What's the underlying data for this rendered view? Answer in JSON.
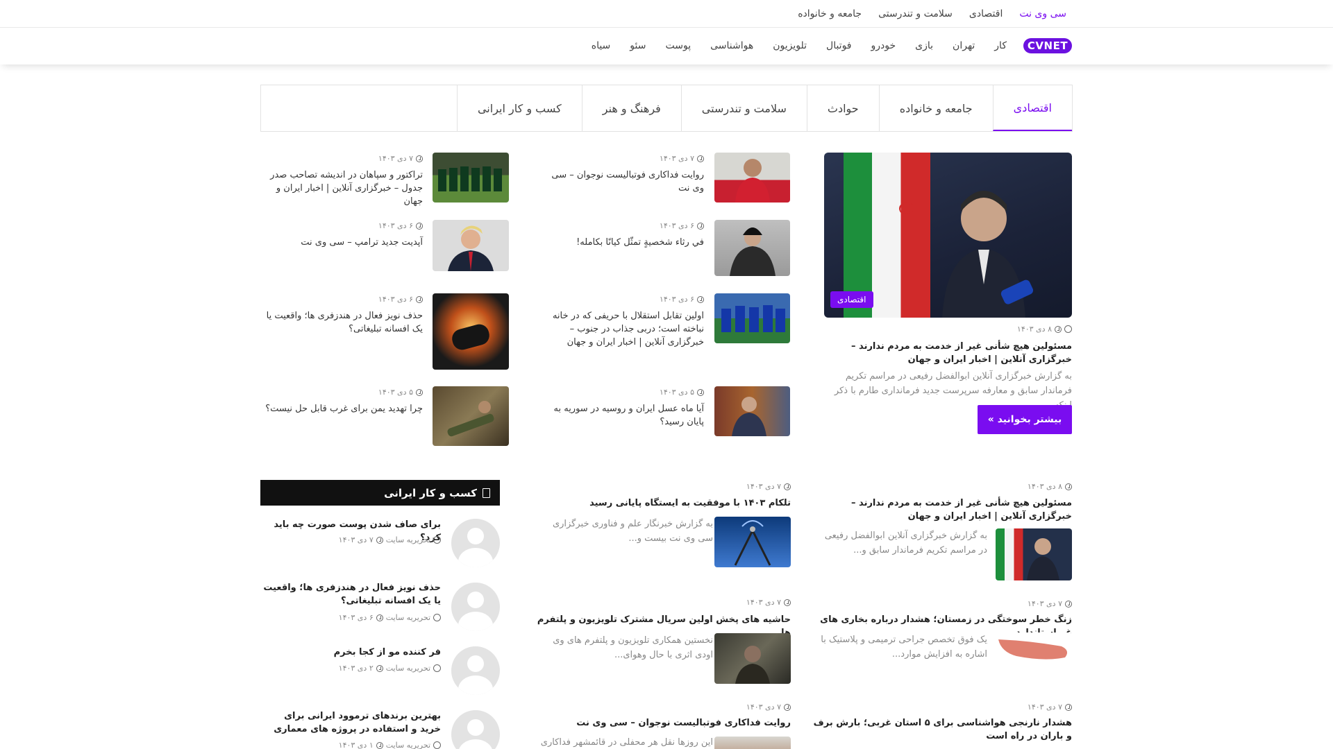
{
  "topbar": {
    "links": [
      "سی وی نت",
      "اقتصادی",
      "سلامت و تندرستی",
      "جامعه و خانواده"
    ]
  },
  "nav": {
    "logo": "CVNET",
    "links": [
      "کار",
      "تهران",
      "بازی",
      "خودرو",
      "فوتبال",
      "تلویزیون",
      "هواشناسی",
      "پوست",
      "سئو",
      "سیاه"
    ]
  },
  "tabs": [
    "اقتصادی",
    "جامعه و خانواده",
    "حوادث",
    "سلامت و تندرستی",
    "فرهنگ و هنر",
    "کسب و کار ایرانی"
  ],
  "featured": {
    "badge": "اقتصادی",
    "date": "۸ دی ۱۴۰۳",
    "title": "مسئولین هیچ شأنی غیر از خدمت به مردم ندارند – خبرگزاری آنلاین | اخبار ایران و جهان",
    "excerpt": "به گزارش خبرگزاری آنلاین ابوالفضل رفیعی در مراسم تکریم فرماندار سابق و معارفه سرپرست جدید فرمانداری طارم با ذکر اینکه...",
    "more": "بیشتر بخوانید »"
  },
  "mid_list": [
    {
      "date": "۷ دی ۱۴۰۳",
      "title": "روایت فداکاری فوتبالیست نوجوان – سی وی نت"
    },
    {
      "date": "۶ دی ۱۴۰۳",
      "title": "في رثاء شخصيةٍ تمثّل كيانًا بكامله!"
    },
    {
      "date": "۶ دی ۱۴۰۳",
      "title": "اولین تقابل استقلال با حریفی که در خانه نباخته است؛ دربی جذاب در جنوب – خبرگزاری آنلاین | اخبار ایران و جهان"
    },
    {
      "date": "۵ دی ۱۴۰۳",
      "title": "آیا ماه عسل ایران و روسیه در سوریه به پایان رسید؟"
    }
  ],
  "left_list": [
    {
      "date": "۷ دی ۱۴۰۳",
      "title": "تراکتور و سپاهان در اندیشه تصاحب صدر جدول – خبرگزاری آنلاین | اخبار ایران و جهان"
    },
    {
      "date": "۶ دی ۱۴۰۳",
      "title": "آپدیت جدید ترامپ – سی وی نت"
    },
    {
      "date": "۶ دی ۱۴۰۳",
      "title": "حذف نویز فعال در هندزفری ها؛ واقعیت یا یک افسانه تبلیغاتی؟"
    },
    {
      "date": "۵ دی ۱۴۰۳",
      "title": "چرا تهدید یمن برای غرب قابل حل نیست؟"
    }
  ],
  "bottom_right": [
    {
      "date": "۸ دی ۱۴۰۳",
      "title": "مسئولین هیچ شأنی غیر از خدمت به مردم ندارند – خبرگزاری آنلاین | اخبار ایران و جهان",
      "excerpt": "به گزارش خبرگزاری آنلاین ابوالفضل رفیعی در مراسم تکریم فرماندار سابق و..."
    },
    {
      "date": "۷ دی ۱۴۰۳",
      "title": "زنگ خطر سوختگی در زمستان؛ هشدار درباره بخاری های غیراستاندارد",
      "excerpt": "یک فوق تخصص جراحی ترمیمی و پلاستیک با اشاره به افزایش موارد..."
    },
    {
      "date": "۷ دی ۱۴۰۳",
      "title": "هشدار نارنجی هواشناسی برای ۵ استان غربی؛ بارش برف و باران در راه است",
      "excerpt": ""
    }
  ],
  "bottom_mid": [
    {
      "date": "۷ دی ۱۴۰۳",
      "title": "تلکام ۱۴۰۳ با موفقیت به ایستگاه پایانی رسید",
      "excerpt": "به گزارش خبرنگار علم و فناوری خبرگزاری سی وی نت بیست و..."
    },
    {
      "date": "۷ دی ۱۴۰۳",
      "title": "حاشیه های پخش اولین سریال مشترک تلویزیون و پلتفرم ها",
      "excerpt": "نخستین همکاری تلویزیون و پلتفرم های وی اودی اثری با حال وهوای..."
    },
    {
      "date": "۷ دی ۱۴۰۳",
      "title": "روایت فداکاری فوتبالیست نوجوان – سی وی نت",
      "excerpt": "این روزها نقل هر محفلی در قائمشهر فداکاری"
    }
  ],
  "sidebar": {
    "heading": "کسب و کار ایرانی",
    "items": [
      {
        "title": "برای صاف شدن پوست صورت چه باید کرد؟",
        "author": "تحریریه سایت",
        "date": "۷ دی ۱۴۰۳"
      },
      {
        "title": "حذف نویز فعال در هندزفری ها؛ واقعیت یا یک افسانه تبلیغاتی؟",
        "author": "تحریریه سایت",
        "date": "۶ دی ۱۴۰۳"
      },
      {
        "title": "فر کننده مو از کجا بخرم",
        "author": "تحریریه سایت",
        "date": "۲ دی ۱۴۰۳"
      },
      {
        "title": "بهترین برندهای ترموود ایرانی برای خرید و استفاده در پروژه های معماری",
        "author": "تحریریه سایت",
        "date": "۱ دی ۱۴۰۳"
      }
    ]
  },
  "colors": {
    "accent": "#7a0df0",
    "dark": "#111111"
  }
}
